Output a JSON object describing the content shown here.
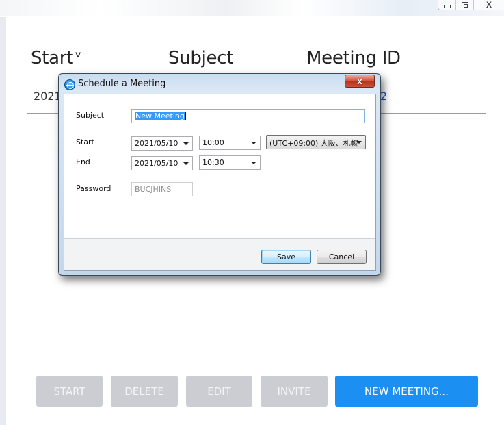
{
  "window": {
    "controls": {
      "minimize": "minimize",
      "maximize": "maximize",
      "close": "X"
    }
  },
  "table": {
    "headers": {
      "start": "Start",
      "subject": "Subject",
      "meeting_id": "Meeting ID"
    },
    "sort_icon": "chevron-down",
    "sort_glyph": "˅",
    "rows": [
      {
        "start": "2021",
        "meeting_id": "2"
      }
    ]
  },
  "actions": {
    "start": "START",
    "delete": "DELETE",
    "edit": "EDIT",
    "invite": "INVITE",
    "new_meeting": "NEW MEETING...",
    "accent_color": "#1b8ff2",
    "disabled_color": "#cbcdd2"
  },
  "dialog": {
    "title": "Schedule a Meeting",
    "close_glyph": "x",
    "subject_label": "Subject",
    "subject_value": "New Meeting",
    "start_label": "Start",
    "start_date": "2021/05/10",
    "start_time": "10:00",
    "timezone": "(UTC+09:00) 大阪、札幌",
    "end_label": "End",
    "end_date": "2021/05/10",
    "end_time": "10:30",
    "password_label": "Password",
    "password_value": "BUCJHINS",
    "save_label": "Save",
    "cancel_label": "Cancel"
  }
}
